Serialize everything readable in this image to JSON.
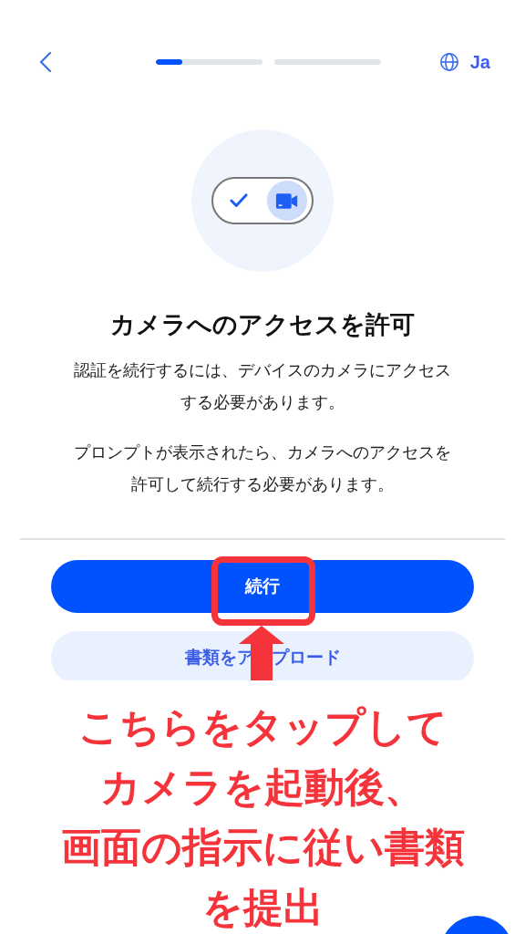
{
  "header": {
    "language": "Ja"
  },
  "progress": {
    "level": 0.25
  },
  "permission_toggle": {
    "on": true
  },
  "title": "カメラへのアクセスを許可",
  "paragraphs": [
    "認証を続行するには、デバイスのカメラにアクセスする必要があります。",
    "プロンプトが表示されたら、カメラへのアクセスを許可して続行する必要があります。"
  ],
  "buttons": [
    {
      "kind": "primary",
      "label": "続行"
    },
    {
      "kind": "secondary",
      "label": "書類をア　プロード"
    }
  ],
  "annotation": {
    "lines": [
      "こちらをタップして",
      "カメラを起動後、",
      "画面の指示に従い書類",
      "を提出"
    ]
  }
}
